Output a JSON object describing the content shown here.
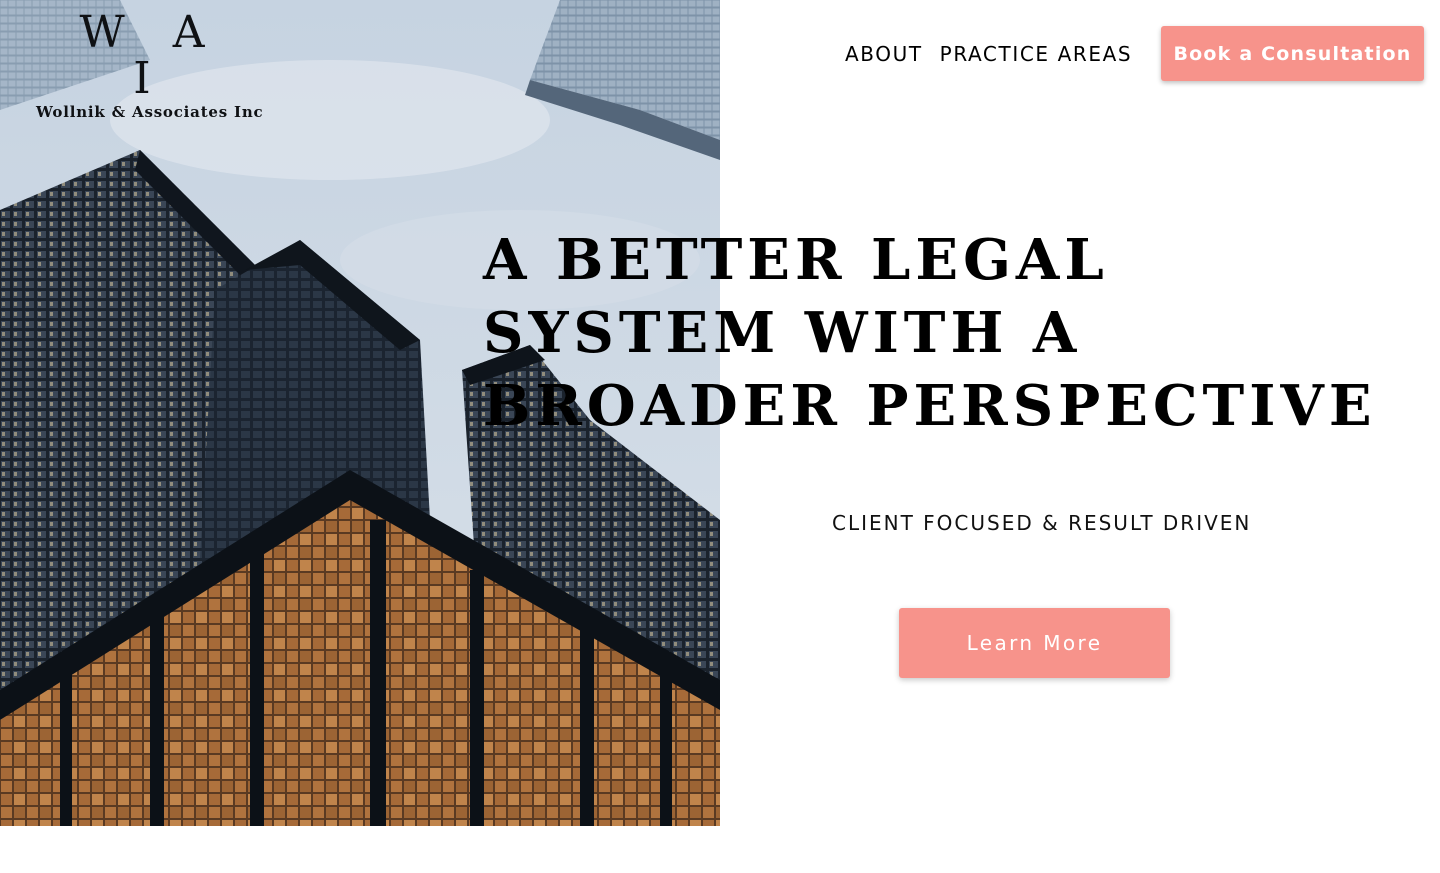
{
  "brand": {
    "logo_mark": "W A I",
    "logo_name": "Wollnik & Associates Inc"
  },
  "nav": {
    "items": [
      {
        "label": "ABOUT"
      },
      {
        "label": "PRACTICE AREAS"
      }
    ],
    "cta_label": "Book a Consultation"
  },
  "hero": {
    "headline_lines": [
      "A BETTER LEGAL",
      "SYSTEM WITH A",
      "BROADER PERSPECTIVE"
    ],
    "tagline": "CLIENT FOCUSED & RESULT DRIVEN",
    "button_label": "Learn More"
  },
  "colors": {
    "accent": "#f7938b",
    "text": "#000000",
    "background": "#ffffff"
  }
}
